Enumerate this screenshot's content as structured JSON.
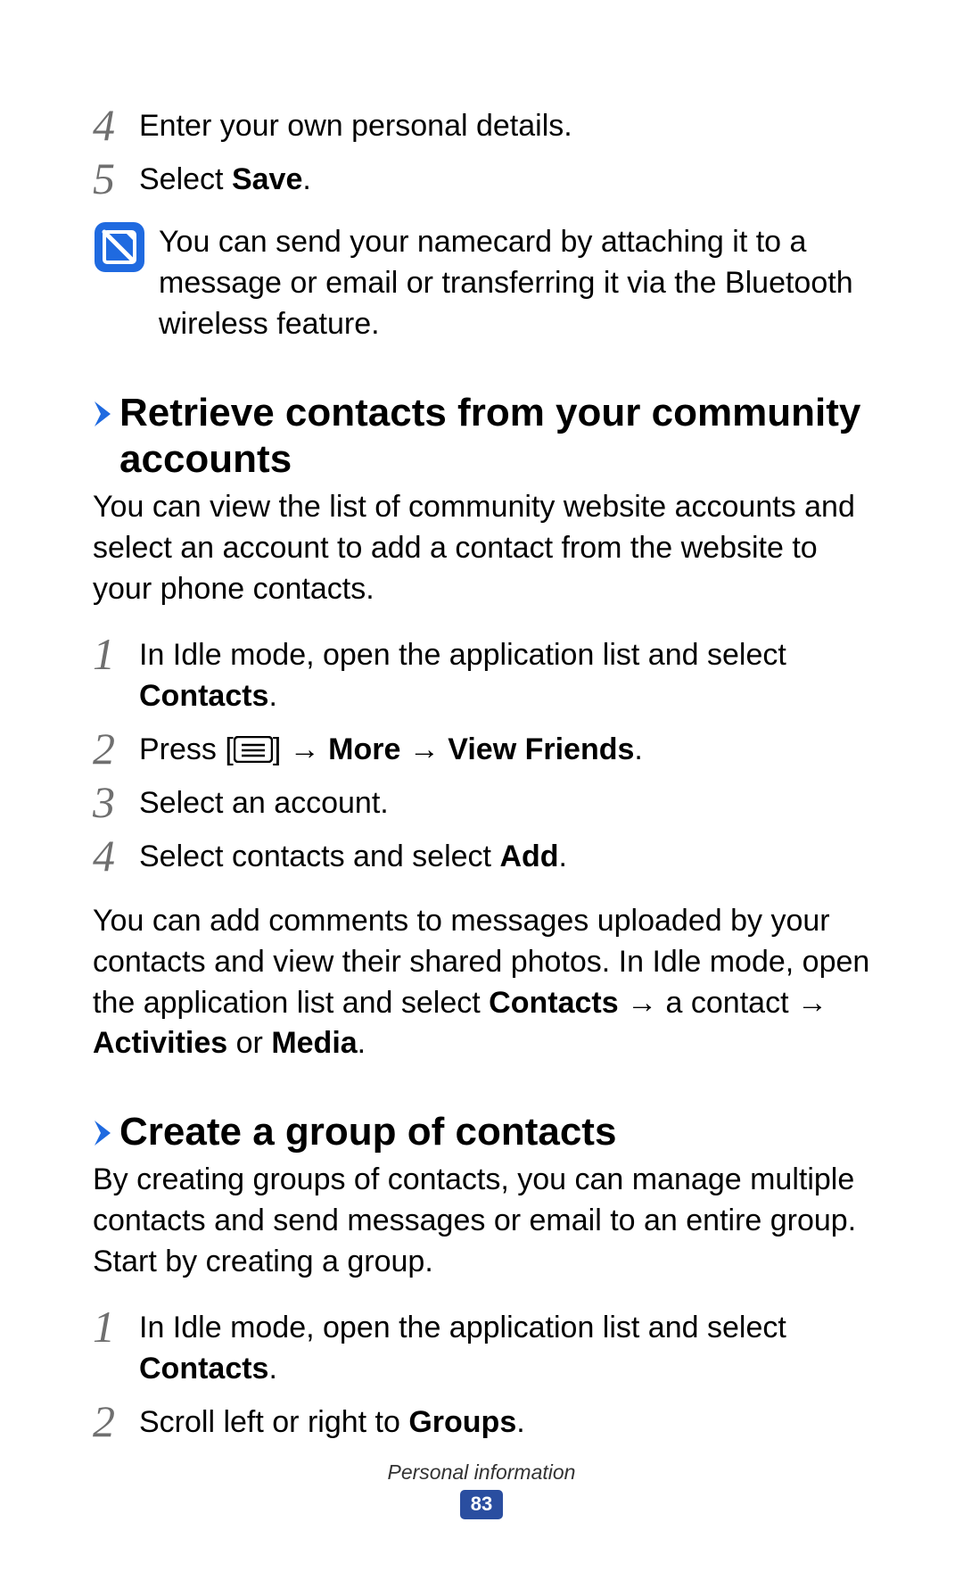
{
  "top_steps": {
    "s4": {
      "num": "4",
      "text": "Enter your own personal details."
    },
    "s5": {
      "num": "5",
      "pre": "Select ",
      "bold": "Save",
      "post": "."
    }
  },
  "note": {
    "text": "You can send your namecard by attaching it to a message or email or transferring it via the Bluetooth wireless feature."
  },
  "section1": {
    "heading": "Retrieve contacts from your community accounts",
    "intro": "You can view the list of community website accounts and select an account to add a contact from the website to your phone contacts.",
    "steps": {
      "s1": {
        "num": "1",
        "pre": "In Idle mode, open the application list and select ",
        "bold": "Contacts",
        "post": "."
      },
      "s2": {
        "num": "2",
        "pre": "Press [",
        "mid": "] → ",
        "bold1": "More",
        "arrow": " → ",
        "bold2": "View Friends",
        "post": "."
      },
      "s3": {
        "num": "3",
        "text": "Select an account."
      },
      "s4": {
        "num": "4",
        "pre": "Select contacts and select ",
        "bold": "Add",
        "post": "."
      }
    },
    "after_pre": "You can add comments to messages uploaded by your contacts and view their shared photos. In Idle mode, open the application list and select ",
    "after_b1": "Contacts",
    "after_mid1": " → a contact → ",
    "after_b2": "Activities",
    "after_mid2": " or ",
    "after_b3": "Media",
    "after_post": "."
  },
  "section2": {
    "heading": "Create a group of contacts",
    "intro": "By creating groups of contacts, you can manage multiple contacts and send messages or email to an entire group. Start by creating a group.",
    "steps": {
      "s1": {
        "num": "1",
        "pre": "In Idle mode, open the application list and select ",
        "bold": "Contacts",
        "post": "."
      },
      "s2": {
        "num": "2",
        "pre": "Scroll left or right to ",
        "bold": "Groups",
        "post": "."
      }
    }
  },
  "footer": {
    "chapter": "Personal information",
    "page": "83"
  }
}
